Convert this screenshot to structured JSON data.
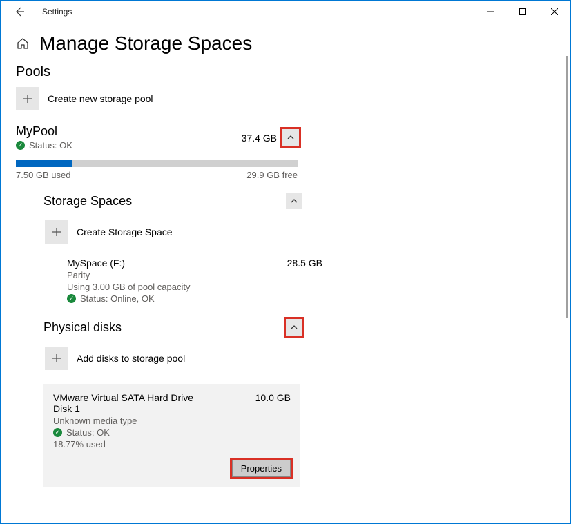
{
  "window": {
    "title": "Settings"
  },
  "page": {
    "title": "Manage Storage Spaces"
  },
  "pools_section": {
    "heading": "Pools",
    "create_label": "Create new storage pool"
  },
  "pool": {
    "name": "MyPool",
    "size": "37.4 GB",
    "status": "Status: OK",
    "used": "7.50 GB used",
    "free": "29.9 GB free",
    "progress_percent": 20
  },
  "spaces_section": {
    "heading": "Storage Spaces",
    "create_label": "Create Storage Space"
  },
  "space": {
    "name": "MySpace (F:)",
    "size": "28.5 GB",
    "type": "Parity",
    "usage": "Using 3.00 GB of pool capacity",
    "status": "Status: Online, OK"
  },
  "disks_section": {
    "heading": "Physical disks",
    "add_label": "Add disks to storage pool"
  },
  "disk": {
    "name": "VMware Virtual SATA Hard Drive Disk 1",
    "size": "10.0 GB",
    "media": "Unknown media type",
    "status": "Status: OK",
    "used": "18.77% used",
    "properties_label": "Properties"
  }
}
